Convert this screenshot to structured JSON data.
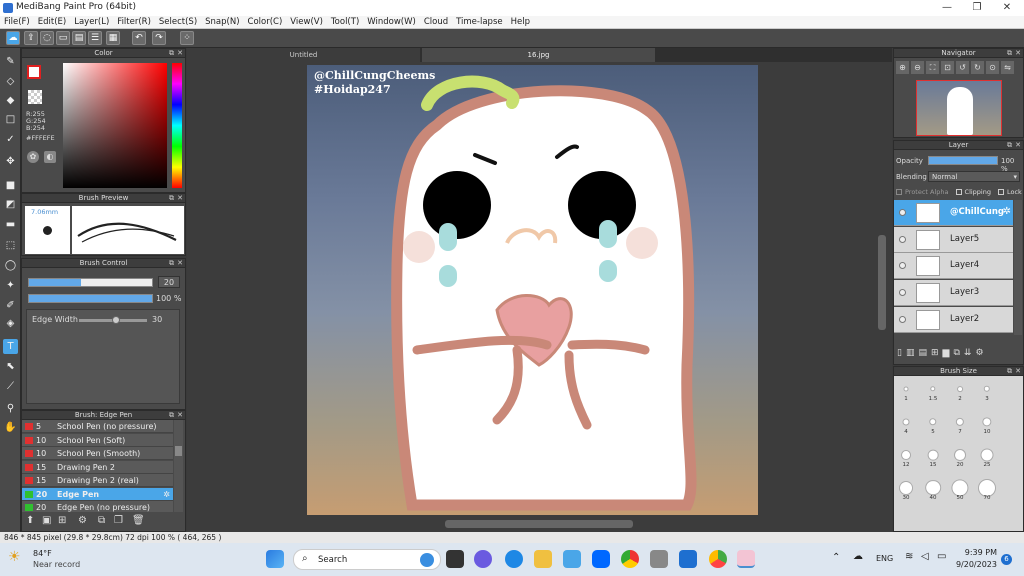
{
  "window": {
    "title": "MediBang Paint Pro (64bit)",
    "minimize": "—",
    "restore": "❐",
    "close": "✕"
  },
  "menu": [
    "File(F)",
    "Edit(E)",
    "Layer(L)",
    "Filter(R)",
    "Select(S)",
    "Snap(N)",
    "Color(C)",
    "View(V)",
    "Tool(T)",
    "Window(W)",
    "Cloud",
    "Time-lapse",
    "Help"
  ],
  "color_panel": {
    "title": "Color",
    "r": "R:255",
    "g": "G:254",
    "b": "B:254",
    "hex": "#FFFEFE"
  },
  "brush_preview": {
    "title": "Brush Preview",
    "size": "7.06mm"
  },
  "brush_control": {
    "title": "Brush Control",
    "size_value": "20",
    "size_fraction": 0.42,
    "opacity_value": "100 %",
    "opacity_fraction": 1.0,
    "edge_label": "Edge Width",
    "edge_value": "30",
    "edge_fraction": 0.55
  },
  "brush_list": {
    "title": "Brush: Edge Pen",
    "items": [
      {
        "num": "5",
        "label": "School Pen (no pressure)",
        "color": "#e03030"
      },
      {
        "num": "10",
        "label": "School Pen (Soft)",
        "color": "#e03030"
      },
      {
        "num": "10",
        "label": "School Pen (Smooth)",
        "color": "#e03030"
      },
      {
        "num": "15",
        "label": "Drawing Pen 2",
        "color": "#e03030"
      },
      {
        "num": "15",
        "label": "Drawing Pen 2 (real)",
        "color": "#e03030"
      },
      {
        "num": "20",
        "label": "Edge Pen",
        "color": "#30c030",
        "selected": true
      },
      {
        "num": "20",
        "label": "Edge Pen (no pressure)",
        "color": "#30c030"
      }
    ]
  },
  "tabs": [
    {
      "label": "Untitled"
    },
    {
      "label": "16.jpg"
    }
  ],
  "canvas": {
    "watermark1": "@ChillCungCheems",
    "watermark2": "#Hoidap247"
  },
  "navigator": {
    "title": "Navigator"
  },
  "layer_panel": {
    "title": "Layer",
    "opacity_label": "Opacity",
    "opacity_value": "100 %",
    "opacity_fraction": 1.0,
    "blending_label": "Blending",
    "blending_value": "Normal",
    "protect_alpha": "Protect Alpha",
    "clipping": "Clipping",
    "lock": "Lock",
    "layers": [
      {
        "label": "@ChillCung",
        "selected": true
      },
      {
        "label": "Layer5"
      },
      {
        "label": "Layer4"
      },
      {
        "label": "Layer3"
      },
      {
        "label": "Layer2"
      }
    ]
  },
  "brush_size": {
    "title": "Brush Size",
    "values": [
      "1",
      "1.5",
      "2",
      "3",
      "4",
      "5",
      "7",
      "10",
      "12",
      "15",
      "20",
      "25",
      "30",
      "40",
      "50",
      "70"
    ]
  },
  "status": {
    "text": "846 * 845 pixel  (29.8 * 29.8cm)  72 dpi  100 %  ( 464, 265 )"
  },
  "taskbar": {
    "weather_temp": "84°F",
    "weather_desc": "Near record",
    "search": "Search",
    "lang": "ENG",
    "time": "9:39 PM",
    "date": "9/20/2023",
    "notif": "6"
  }
}
